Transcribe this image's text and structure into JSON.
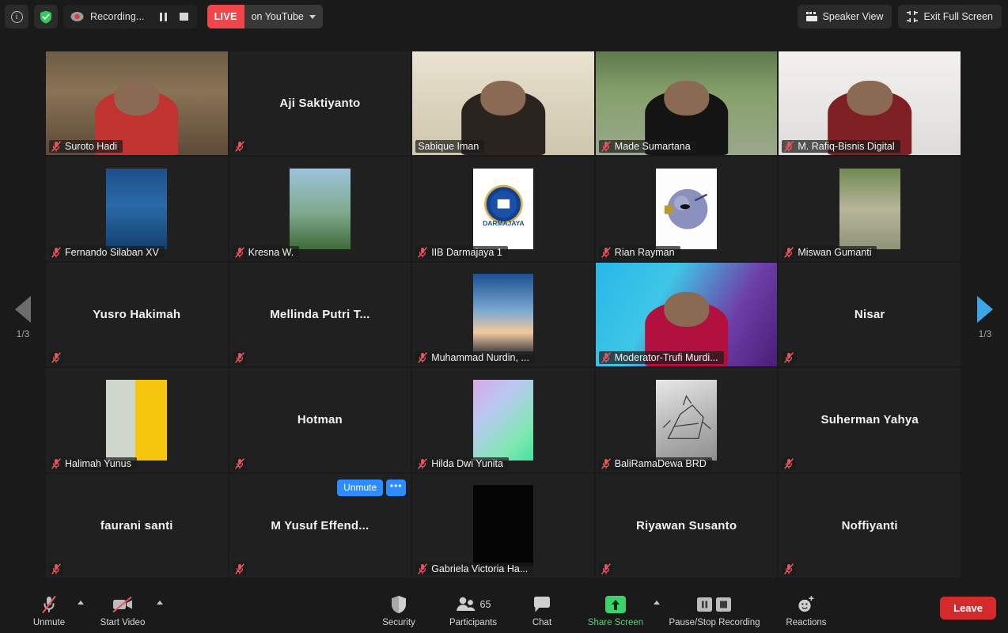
{
  "topbar": {
    "info_icon": "info-circle-icon",
    "encryption_icon": "green-shield-icon",
    "recording_label": "Recording...",
    "recording_icon": "recording-dot-icon",
    "pause_icon": "pause-icon",
    "stop_icon": "stop-icon",
    "live_badge": "LIVE",
    "live_destination": "on YouTube",
    "speaker_view_label": "Speaker View",
    "speaker_view_icon": "grid-view-icon",
    "exit_full_screen_label": "Exit Full Screen",
    "exit_full_screen_icon": "collapse-arrows-icon"
  },
  "pager": {
    "left_label": "1/3",
    "right_label": "1/3",
    "left_icon": "chevron-left-icon",
    "right_icon": "chevron-right-icon"
  },
  "gallery": {
    "columns": 5,
    "rows": 5,
    "active_speaker_color": "#a4d03c",
    "participants": [
      {
        "name": "Suroto Hadi",
        "label_style": "bar",
        "muted": true,
        "video": "photo-man-red-shirt-workshop",
        "art": "suroto",
        "active": false
      },
      {
        "name": "Aji Saktiyanto",
        "label_style": "center",
        "muted": true,
        "video": "none",
        "art": "none",
        "active": false
      },
      {
        "name": "Sabique Iman",
        "label_style": "bar",
        "muted": false,
        "video": "photo-young-man-glasses",
        "art": "sabique",
        "active": true
      },
      {
        "name": "Made Sumartana",
        "label_style": "bar",
        "muted": true,
        "video": "photo-outdoor-trees",
        "art": "made",
        "active": false
      },
      {
        "name": "M. Rafiq-Bisnis Digital",
        "label_style": "bar",
        "muted": true,
        "video": "photo-man-maroon-shirt",
        "art": "rafiq",
        "active": false
      },
      {
        "name": "Fernando Silaban XV",
        "label_style": "bar",
        "muted": true,
        "video": "avatar-blue-pool",
        "art": "fernando",
        "active": false
      },
      {
        "name": "Kresna W.",
        "label_style": "bar",
        "muted": true,
        "video": "avatar-man-field",
        "art": "kresna",
        "active": false
      },
      {
        "name": "IIB Darmajaya 1",
        "label_style": "bar",
        "muted": true,
        "video": "avatar-darmajaya-logo",
        "art": "darmajaya",
        "active": false
      },
      {
        "name": "Rian Rayman",
        "label_style": "bar",
        "muted": true,
        "video": "avatar-cartoon-sphere",
        "art": "rian",
        "active": false
      },
      {
        "name": "Miswan Gumanti",
        "label_style": "bar",
        "muted": true,
        "video": "avatar-man-glasses-palms",
        "art": "miswan",
        "active": false
      },
      {
        "name": "Yusro Hakimah",
        "label_style": "center",
        "muted": true,
        "video": "none",
        "art": "none",
        "active": false
      },
      {
        "name": "Mellinda  Putri  T...",
        "label_style": "center",
        "muted": true,
        "video": "none",
        "art": "none",
        "active": false
      },
      {
        "name": "Muhammad Nurdin, ...",
        "label_style": "bar",
        "muted": true,
        "video": "avatar-sunset-river",
        "art": "nurdin",
        "active": false
      },
      {
        "name": "Moderator-Trufi Murdi...",
        "label_style": "bar",
        "muted": true,
        "video": "photo-webinar-background",
        "art": "trufi",
        "active": false
      },
      {
        "name": "Nisar",
        "label_style": "center",
        "muted": true,
        "video": "none",
        "art": "none",
        "active": false
      },
      {
        "name": "Halimah Yunus",
        "label_style": "bar",
        "muted": true,
        "video": "avatar-poster-yellow",
        "art": "halimah",
        "active": false
      },
      {
        "name": "Hotman",
        "label_style": "center",
        "muted": true,
        "video": "none",
        "art": "none",
        "active": false
      },
      {
        "name": "Hilda Dwi Yunita",
        "label_style": "bar",
        "muted": true,
        "video": "avatar-pastel-stars",
        "art": "hilda",
        "active": false
      },
      {
        "name": "BaliRamaDewa BRD",
        "label_style": "bar",
        "muted": true,
        "video": "avatar-gundam-sketch",
        "art": "bali",
        "active": false
      },
      {
        "name": "Suherman Yahya",
        "label_style": "center",
        "muted": true,
        "video": "none",
        "art": "none",
        "active": false
      },
      {
        "name": "faurani santi",
        "label_style": "center",
        "muted": true,
        "video": "none",
        "art": "none",
        "active": false
      },
      {
        "name": "M Yusuf Effend...",
        "label_style": "center",
        "muted": true,
        "video": "none",
        "art": "none",
        "active": false
      },
      {
        "name": "Gabriela Victoria Ha...",
        "label_style": "bar",
        "muted": true,
        "video": "avatar-black",
        "art": "gabriela",
        "active": false
      },
      {
        "name": "Riyawan Susanto",
        "label_style": "center",
        "muted": true,
        "video": "none",
        "art": "none",
        "active": false
      },
      {
        "name": "Noffiyanti",
        "label_style": "center",
        "muted": true,
        "video": "none",
        "art": "none",
        "active": false
      }
    ],
    "hover_tile_index": 21,
    "hover_controls": {
      "unmute_label": "Unmute",
      "more_label": "•••"
    }
  },
  "bottombar": {
    "items": [
      {
        "label": "Unmute",
        "icon": "mic-muted-icon",
        "has_chevron": true,
        "green": false
      },
      {
        "label": "Start Video",
        "icon": "video-off-icon",
        "has_chevron": true,
        "green": false
      },
      {
        "label": "Security",
        "icon": "shield-icon",
        "has_chevron": false,
        "green": false
      },
      {
        "label": "Participants",
        "icon": "participants-icon",
        "has_chevron": false,
        "green": false,
        "count": "65"
      },
      {
        "label": "Chat",
        "icon": "chat-bubble-icon",
        "has_chevron": false,
        "green": false
      },
      {
        "label": "Share Screen",
        "icon": "share-screen-icon",
        "has_chevron": true,
        "green": true
      },
      {
        "label": "Pause/Stop Recording",
        "icon": "pause-stop-icon",
        "has_chevron": false,
        "green": false
      },
      {
        "label": "Reactions",
        "icon": "reactions-icon",
        "has_chevron": false,
        "green": false
      }
    ],
    "leave_label": "Leave",
    "leave_color": "#d32b2b"
  }
}
